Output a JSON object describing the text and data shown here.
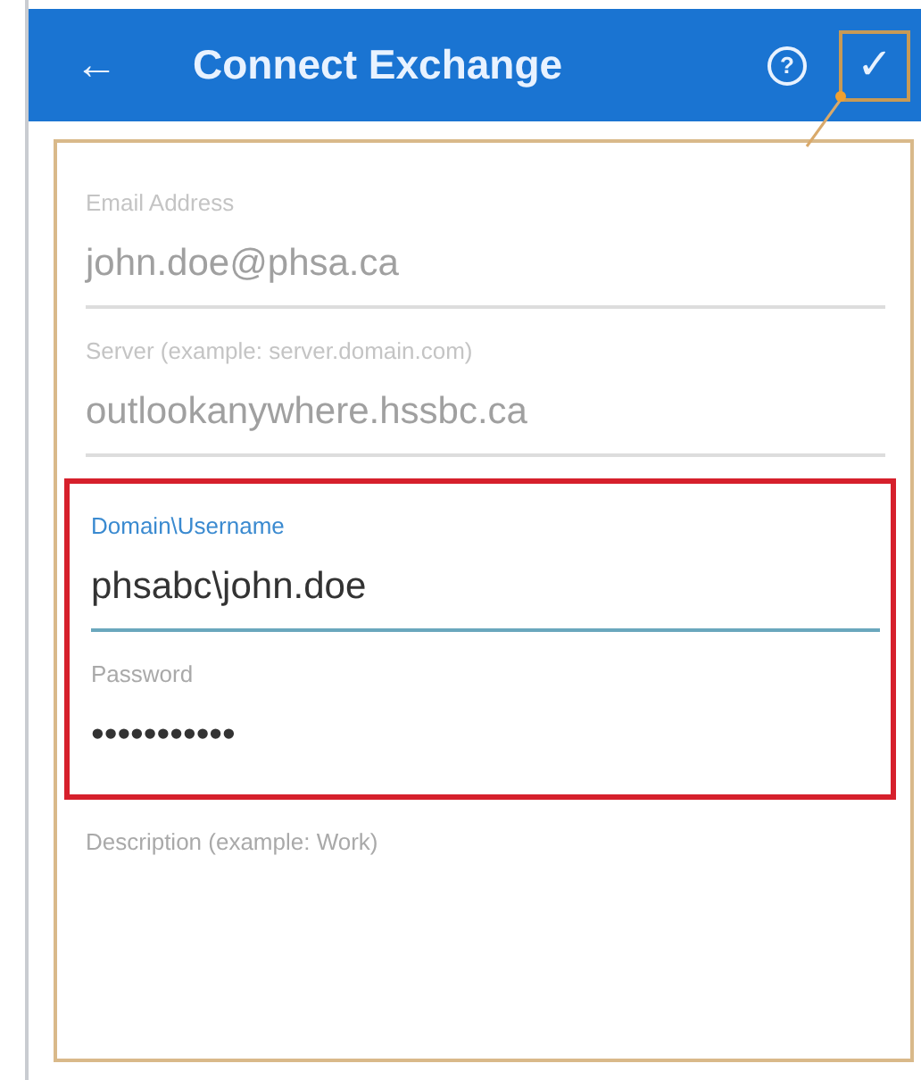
{
  "app_bar": {
    "title": "Connect Exchange",
    "back": "←",
    "help": "?",
    "confirm": {
      "label": "✓",
      "callout": true
    }
  },
  "fields": [
    {
      "kind": "field",
      "label": "Email Address",
      "value": "john.doe@phsa.ca",
      "disabled": true,
      "focused": false
    },
    {
      "kind": "field",
      "label": "Server (example: server.domain.com)",
      "value": "outlookanywhere.hssbc.ca",
      "disabled": true,
      "focused": false
    },
    {
      "kind": "highlight_group",
      "fields": [
        {
          "label": "Domain\\Username",
          "value": "phsabc\\john.doe",
          "disabled": false,
          "focused": true
        },
        {
          "label": "Password",
          "value": "•••••••••••",
          "disabled": false,
          "focused": false
        }
      ]
    },
    {
      "kind": "field",
      "label": "Description (example: Work)",
      "disabled": false,
      "focused": false
    }
  ]
}
